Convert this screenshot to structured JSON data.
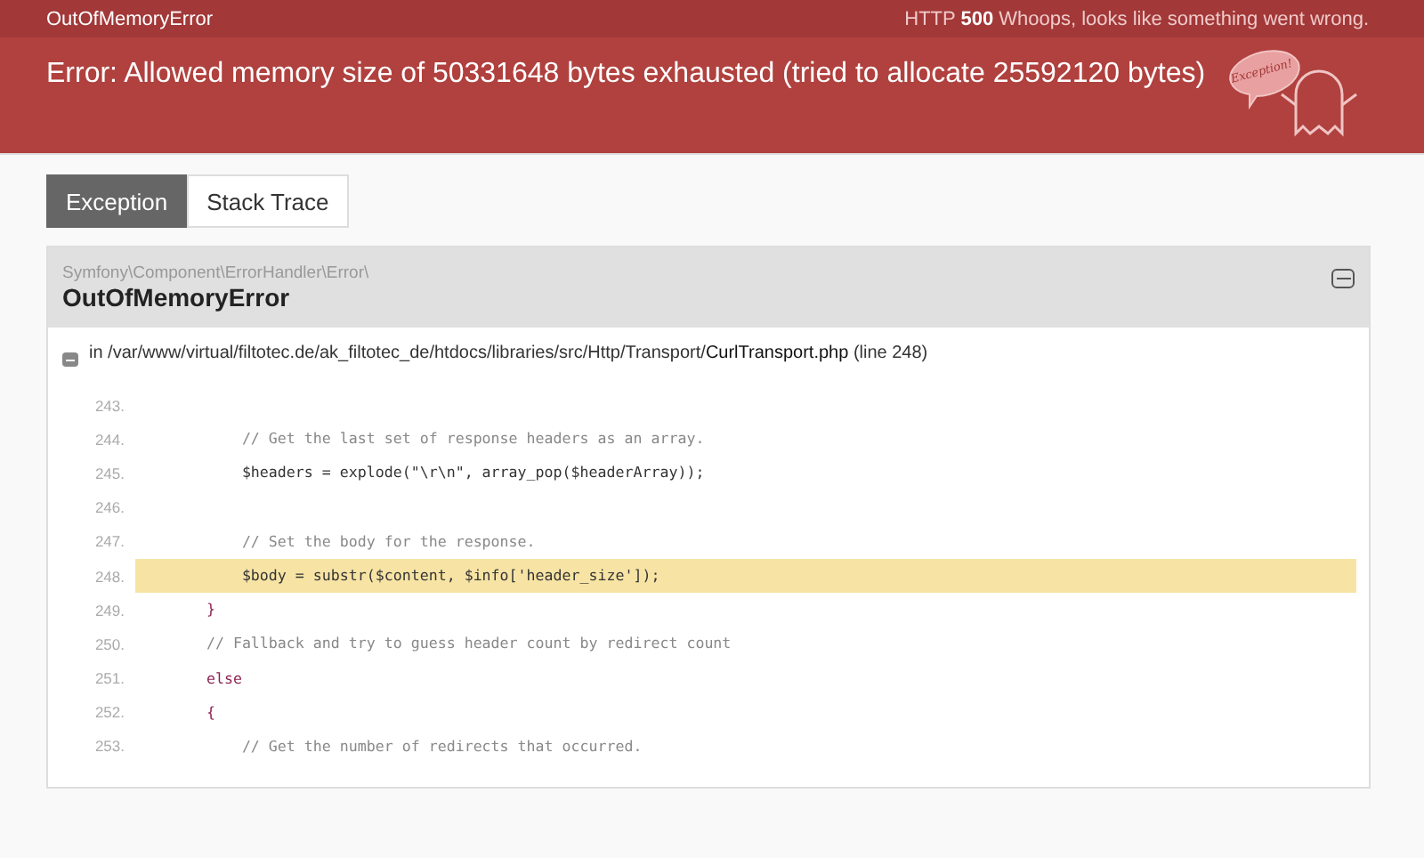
{
  "top_bar": {
    "error_class": "OutOfMemoryError",
    "status_label": "HTTP",
    "status_code": "500",
    "status_message": "Whoops, looks like something went wrong."
  },
  "header": {
    "message": "Error: Allowed memory size of 50331648 bytes exhausted (tried to allocate 25592120 bytes)",
    "logo_bubble": "Exception!"
  },
  "tabs": [
    {
      "label": "Exception",
      "selected": true
    },
    {
      "label": "Stack Trace",
      "selected": false
    }
  ],
  "exception": {
    "namespace": "Symfony\\Component\\ErrorHandler\\Error\\",
    "class": "OutOfMemoryError",
    "expanded": true,
    "location": {
      "prefix": "in",
      "path": "/var/www/virtual/filtotec.de/ak_filtotec_de/htdocs/libraries/src/Http/Transport/",
      "file": "CurlTransport.php",
      "line": "(line 248)"
    },
    "code_lines": [
      {
        "number": "243.",
        "kind": "blank",
        "highlighted": false
      },
      {
        "number": "244.",
        "kind": "comment",
        "text": "            // Get the last set of response headers as an array.",
        "highlighted": false
      },
      {
        "number": "245.",
        "kind": "code",
        "text": "            $headers = explode(\"\\r\\n\", array_pop($headerArray));",
        "highlighted": false
      },
      {
        "number": "246.",
        "kind": "blank",
        "highlighted": false
      },
      {
        "number": "247.",
        "kind": "comment",
        "text": "            // Set the body for the response.",
        "highlighted": false
      },
      {
        "number": "248.",
        "kind": "code",
        "text": "            $body = substr($content, $info['header_size']);",
        "highlighted": true
      },
      {
        "number": "249.",
        "kind": "keyword",
        "text": "        }",
        "highlighted": false
      },
      {
        "number": "250.",
        "kind": "comment",
        "text": "        // Fallback and try to guess header count by redirect count",
        "highlighted": false
      },
      {
        "number": "251.",
        "kind": "keyword",
        "text": "        else",
        "highlighted": false
      },
      {
        "number": "252.",
        "kind": "keyword",
        "text": "        {",
        "highlighted": false
      },
      {
        "number": "253.",
        "kind": "comment",
        "text": "            // Get the number of redirects that occurred.",
        "highlighted": false
      }
    ]
  }
}
